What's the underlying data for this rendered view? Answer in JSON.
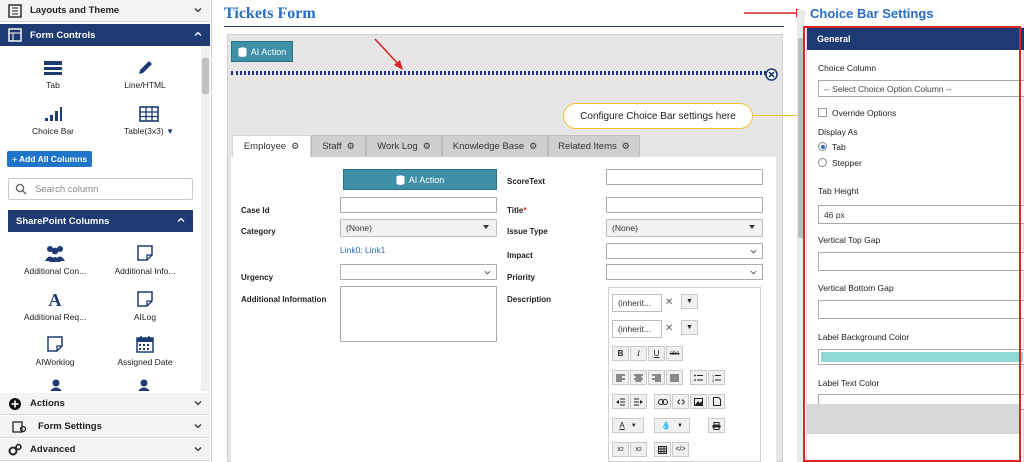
{
  "left_panel": {
    "layouts_theme": "Layouts and Theme",
    "form_controls": "Form Controls",
    "controls": [
      "Tab",
      "Line/HTML",
      "Choice Bar",
      "Table(3x3)"
    ],
    "add_all_columns": "+ Add All Columns",
    "search_placeholder": "Search column",
    "sharepoint_columns": "SharePoint Columns",
    "sp_items": [
      "Additional Con...",
      "Additional Info...",
      "Additional Req...",
      "AILog",
      "AIWorklog",
      "Assigned Date"
    ],
    "actions": "Actions",
    "form_settings": "Form Settings",
    "advanced": "Advanced"
  },
  "form": {
    "title": "Tickets Form",
    "ai_action": "AI Action",
    "tooltip": "Configure Choice Bar settings here",
    "tabs": [
      "Employee",
      "Staff",
      "Work Log",
      "Knowledge Base",
      "Related Items"
    ],
    "ai_action_inner": "AI Action",
    "labels": {
      "case_id": "Case Id",
      "category": "Category",
      "urgency": "Urgency",
      "additional_information": "Additional Information",
      "score_text": "ScoreText",
      "title": "Title",
      "issue_type": "Issue Type",
      "impact": "Impact",
      "priority": "Priority",
      "description": "Description"
    },
    "required_mark": "*",
    "category_value": "(None)",
    "issue_type_value": "(None)",
    "links": "Link0; Link1",
    "font_inherit_1": "(inherit...",
    "font_inherit_2": "(inherit..."
  },
  "right_panel": {
    "heading": "Choice Bar Settings",
    "general": "General",
    "choice_column": "Choice Column",
    "choice_column_placeholder": "-- Select Choice Option Column --",
    "override_options": "Override Options",
    "display_as": "Display As",
    "display_tab": "Tab",
    "display_stepper": "Stepper",
    "tab_height": "Tab Height",
    "tab_height_value": "46 px",
    "vertical_top_gap": "Vertical Top Gap",
    "vertical_bottom_gap": "Vertical Bottom Gap",
    "label_background_color": "Label Background Color",
    "label_background_color_value": "#8fd8d4",
    "label_text_color": "Label Text Color"
  },
  "colors": {
    "navy": "#1d3a72",
    "accent_blue": "#2a6cc1",
    "teal_button": "#3e8fa8",
    "annotation_red": "#d92626",
    "tooltip_border": "#f1c232"
  }
}
